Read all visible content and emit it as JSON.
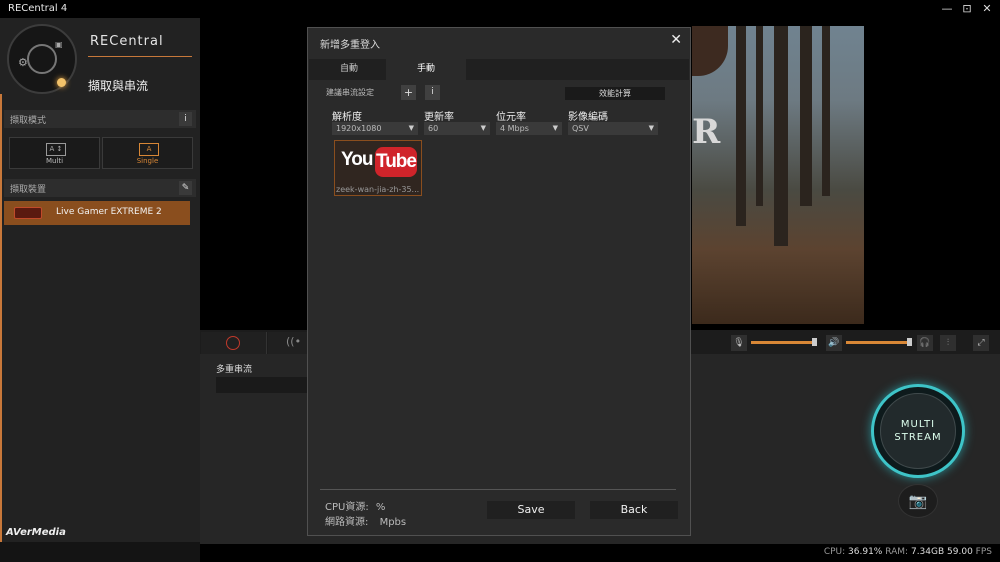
{
  "window": {
    "title": "RECentral 4",
    "controls": [
      "—",
      "⊡",
      "✕"
    ]
  },
  "sidebar": {
    "brand": "RECentral",
    "mode": "擷取與串流",
    "capture_mode_header": "擷取模式",
    "capture_mode_info": "i",
    "capture_modes": [
      {
        "label": "Multi",
        "icon_text": "A ↕"
      },
      {
        "label": "Single",
        "icon_text": "A",
        "selected": true
      }
    ],
    "capture_device_header": "擷取裝置",
    "device": "Live Gamer EXTREME 2",
    "logo": "AVerMedia"
  },
  "main": {
    "multistream_label": "多重串流",
    "big_button": {
      "line1": "MULTI",
      "line2": "STREAM"
    },
    "preview_letter": "R"
  },
  "statusbar": {
    "cpu_label": "CPU:",
    "cpu_value": "36.91%",
    "ram_label": "RAM:",
    "ram_value": "7.34GB",
    "fps_value": "59.00",
    "fps_label": "FPS"
  },
  "dialog": {
    "title": "新增多重登入",
    "close": "✕",
    "tabs": [
      "自動",
      "手動"
    ],
    "active_tab": 1,
    "recommend_label": "建議串流設定",
    "add_btn": "+",
    "info_btn": "i",
    "perf_btn": "效能計算",
    "columns": [
      {
        "header": "解析度",
        "value": "1920x1080"
      },
      {
        "header": "更新率",
        "value": "60"
      },
      {
        "header": "位元率",
        "value": "4 Mbps"
      },
      {
        "header": "影像編碼",
        "value": "QSV"
      }
    ],
    "platform": {
      "logo_you": "You",
      "logo_tube": "Tube",
      "name": "zeek-wan-jia-zh-35..."
    },
    "cpu_res_label": "CPU資源:",
    "cpu_res_unit": "%",
    "net_res_label": "網路資源:",
    "net_res_unit": "Mpbs",
    "save": "Save",
    "back": "Back"
  },
  "colors": {
    "accent": "#d88736",
    "stream_ring": "#3ec4c8",
    "youtube_red": "#d0242a"
  }
}
